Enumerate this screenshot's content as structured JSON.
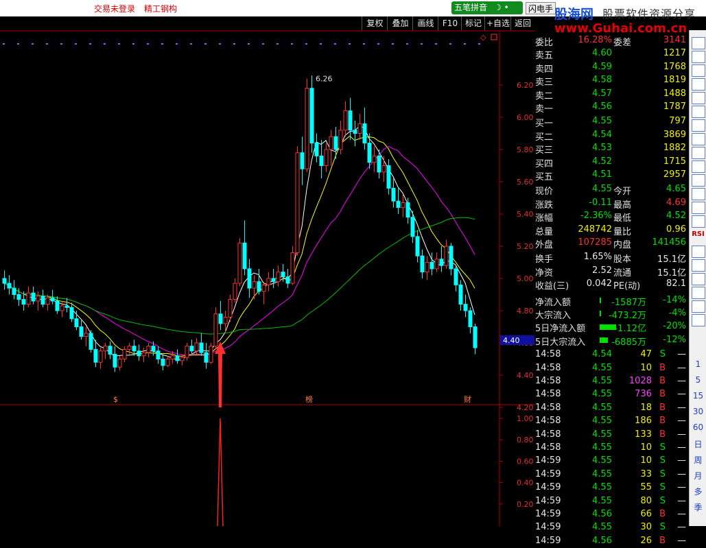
{
  "topbar": {
    "login_status": "交易未登录",
    "stock_name": "精工钢构",
    "ime": "五笔拼音",
    "flash": "闪电手"
  },
  "watermark": {
    "cn": "股海网",
    "tagline": "股票软件资源分享",
    "url": "www.Guhai.com.cn"
  },
  "toolbar": [
    "复权",
    "叠加",
    "画线",
    "F10",
    "标记",
    "+自选",
    "返回"
  ],
  "chart_data": [
    {
      "type": "candlestick",
      "y_ticks": [
        "6.20",
        "6.00",
        "5.80",
        "5.60",
        "5.40",
        "5.20",
        "5.00",
        "4.80",
        "4.60",
        "4.40",
        "4.20"
      ],
      "ylim": [
        4.12,
        6.32
      ],
      "high_label": "6.26",
      "cursor_price": "4.40",
      "series_colors": {
        "up": "#ff3232",
        "down": "#00ffff",
        "ma5": "#ffffff",
        "ma10": "#ffff00",
        "ma20": "#ff00ff",
        "ma60": "#00c000"
      },
      "ohlc": [
        [
          5.0,
          5.05,
          4.93,
          4.97
        ],
        [
          4.97,
          5.02,
          4.9,
          4.94
        ],
        [
          4.94,
          4.99,
          4.87,
          4.9
        ],
        [
          4.9,
          4.94,
          4.83,
          4.87
        ],
        [
          4.87,
          4.92,
          4.8,
          4.84
        ],
        [
          4.84,
          4.95,
          4.82,
          4.91
        ],
        [
          4.91,
          4.95,
          4.84,
          4.86
        ],
        [
          4.86,
          4.92,
          4.8,
          4.89
        ],
        [
          4.89,
          4.93,
          4.82,
          4.84
        ],
        [
          4.84,
          4.9,
          4.8,
          4.88
        ],
        [
          4.88,
          4.93,
          4.84,
          4.86
        ],
        [
          4.86,
          4.89,
          4.78,
          4.8
        ],
        [
          4.8,
          4.86,
          4.76,
          4.83
        ],
        [
          4.83,
          4.88,
          4.79,
          4.82
        ],
        [
          4.82,
          4.85,
          4.73,
          4.75
        ],
        [
          4.75,
          4.8,
          4.68,
          4.7
        ],
        [
          4.7,
          4.74,
          4.62,
          4.64
        ],
        [
          4.64,
          4.7,
          4.58,
          4.66
        ],
        [
          4.66,
          4.68,
          4.54,
          4.56
        ],
        [
          4.56,
          4.62,
          4.45,
          4.48
        ],
        [
          4.48,
          4.57,
          4.44,
          4.55
        ],
        [
          4.55,
          4.6,
          4.5,
          4.58
        ],
        [
          4.58,
          4.61,
          4.5,
          4.53
        ],
        [
          4.53,
          4.58,
          4.42,
          4.45
        ],
        [
          4.45,
          4.52,
          4.43,
          4.5
        ],
        [
          4.5,
          4.58,
          4.48,
          4.56
        ],
        [
          4.56,
          4.6,
          4.53,
          4.58
        ],
        [
          4.58,
          4.62,
          4.52,
          4.55
        ],
        [
          4.55,
          4.59,
          4.49,
          4.52
        ],
        [
          4.52,
          4.57,
          4.48,
          4.54
        ],
        [
          4.54,
          4.6,
          4.51,
          4.58
        ],
        [
          4.58,
          4.61,
          4.52,
          4.55
        ],
        [
          4.55,
          4.58,
          4.47,
          4.5
        ],
        [
          4.5,
          4.53,
          4.43,
          4.46
        ],
        [
          4.46,
          4.52,
          4.45,
          4.5
        ],
        [
          4.5,
          4.55,
          4.47,
          4.52
        ],
        [
          4.52,
          4.56,
          4.47,
          4.49
        ],
        [
          4.49,
          4.53,
          4.46,
          4.51
        ],
        [
          4.51,
          4.6,
          4.49,
          4.58
        ],
        [
          4.58,
          4.62,
          4.53,
          4.55
        ],
        [
          4.55,
          4.63,
          4.52,
          4.6
        ],
        [
          4.6,
          4.66,
          4.52,
          4.54
        ],
        [
          4.54,
          4.6,
          4.44,
          4.48
        ],
        [
          4.48,
          4.6,
          4.47,
          4.58
        ],
        [
          4.58,
          4.82,
          4.56,
          4.78
        ],
        [
          4.78,
          4.86,
          4.68,
          4.72
        ],
        [
          4.72,
          4.8,
          4.66,
          4.76
        ],
        [
          4.76,
          4.9,
          4.73,
          4.87
        ],
        [
          4.87,
          5.0,
          4.85,
          4.97
        ],
        [
          4.97,
          5.25,
          4.95,
          5.22
        ],
        [
          5.22,
          5.36,
          5.02,
          5.06
        ],
        [
          5.06,
          5.12,
          4.88,
          4.94
        ],
        [
          4.94,
          5.02,
          4.87,
          4.98
        ],
        [
          4.98,
          5.06,
          4.9,
          4.92
        ],
        [
          4.92,
          4.98,
          4.84,
          4.96
        ],
        [
          4.96,
          5.04,
          4.92,
          5.0
        ],
        [
          5.0,
          5.06,
          4.94,
          4.98
        ],
        [
          4.98,
          5.08,
          4.95,
          5.04
        ],
        [
          5.04,
          5.09,
          4.98,
          5.01
        ],
        [
          5.01,
          5.06,
          4.94,
          4.97
        ],
        [
          4.97,
          5.2,
          4.96,
          5.16
        ],
        [
          5.16,
          5.82,
          5.14,
          5.78
        ],
        [
          5.78,
          5.88,
          5.58,
          5.68
        ],
        [
          5.68,
          6.24,
          5.66,
          6.18
        ],
        [
          6.18,
          6.26,
          5.78,
          5.84
        ],
        [
          5.84,
          5.9,
          5.72,
          5.76
        ],
        [
          5.76,
          5.86,
          5.62,
          5.7
        ],
        [
          5.7,
          5.84,
          5.66,
          5.8
        ],
        [
          5.8,
          5.92,
          5.7,
          5.88
        ],
        [
          5.88,
          5.94,
          5.74,
          5.8
        ],
        [
          5.8,
          5.98,
          5.77,
          5.92
        ],
        [
          5.92,
          6.1,
          5.88,
          6.04
        ],
        [
          6.04,
          6.12,
          5.86,
          5.92
        ],
        [
          5.92,
          5.98,
          5.82,
          5.9
        ],
        [
          5.9,
          6.02,
          5.86,
          5.96
        ],
        [
          5.96,
          6.06,
          5.8,
          5.84
        ],
        [
          5.84,
          5.9,
          5.68,
          5.72
        ],
        [
          5.72,
          5.82,
          5.66,
          5.76
        ],
        [
          5.76,
          5.8,
          5.62,
          5.66
        ],
        [
          5.66,
          5.76,
          5.6,
          5.7
        ],
        [
          5.7,
          5.74,
          5.52,
          5.56
        ],
        [
          5.56,
          5.62,
          5.44,
          5.48
        ],
        [
          5.48,
          5.56,
          5.4,
          5.44
        ],
        [
          5.44,
          5.52,
          5.38,
          5.47
        ],
        [
          5.47,
          5.5,
          5.34,
          5.38
        ],
        [
          5.38,
          5.42,
          5.22,
          5.26
        ],
        [
          5.26,
          5.3,
          5.1,
          5.14
        ],
        [
          5.14,
          5.18,
          5.0,
          5.04
        ],
        [
          5.04,
          5.14,
          4.99,
          5.1
        ],
        [
          5.1,
          5.16,
          5.02,
          5.06
        ],
        [
          5.06,
          5.16,
          5.04,
          5.12
        ],
        [
          5.12,
          5.2,
          5.04,
          5.08
        ],
        [
          5.08,
          5.24,
          5.06,
          5.2
        ],
        [
          5.2,
          5.22,
          5.02,
          5.06
        ],
        [
          5.06,
          5.08,
          4.92,
          4.96
        ],
        [
          4.96,
          4.99,
          4.8,
          4.84
        ],
        [
          4.84,
          4.9,
          4.76,
          4.8
        ],
        [
          4.8,
          4.82,
          4.66,
          4.7
        ],
        [
          4.7,
          4.72,
          4.53,
          4.57
        ]
      ]
    },
    {
      "type": "signal",
      "y_ticks": [
        "1.00",
        "0.80",
        "0.60",
        "0.40",
        "0.20"
      ],
      "ylim": [
        0,
        1.1
      ],
      "signal_index": 45,
      "signal_value": 1.0
    }
  ],
  "event_markers": [
    {
      "label": "$",
      "index": 23
    },
    {
      "label": "榜",
      "index": 63
    },
    {
      "label": "财",
      "index": 96
    }
  ],
  "quote": {
    "webi_label": "委比",
    "webi": "16.28%",
    "wecha_label": "委差",
    "wecha": "3141",
    "asks": [
      {
        "label": "卖五",
        "price": "4.60",
        "vol": "1217"
      },
      {
        "label": "卖四",
        "price": "4.59",
        "vol": "1768"
      },
      {
        "label": "卖三",
        "price": "4.58",
        "vol": "1819"
      },
      {
        "label": "卖二",
        "price": "4.57",
        "vol": "1488"
      },
      {
        "label": "卖一",
        "price": "4.56",
        "vol": "1787"
      }
    ],
    "bids": [
      {
        "label": "买一",
        "price": "4.55",
        "vol": "797"
      },
      {
        "label": "买二",
        "price": "4.54",
        "vol": "3869"
      },
      {
        "label": "买三",
        "price": "4.53",
        "vol": "1882"
      },
      {
        "label": "买四",
        "price": "4.52",
        "vol": "1715"
      },
      {
        "label": "买五",
        "price": "4.51",
        "vol": "2957"
      }
    ],
    "stats": [
      {
        "l1": "现价",
        "v1": "4.55",
        "c1": "g",
        "l2": "今开",
        "v2": "4.65",
        "c2": "g"
      },
      {
        "l1": "涨跌",
        "v1": "-0.11",
        "c1": "g",
        "l2": "最高",
        "v2": "4.69",
        "c2": "r"
      },
      {
        "l1": "涨幅",
        "v1": "-2.36%",
        "c1": "g",
        "l2": "最低",
        "v2": "4.52",
        "c2": "g"
      },
      {
        "l1": "总量",
        "v1": "248742",
        "c1": "y",
        "l2": "量比",
        "v2": "0.96",
        "c2": "y"
      },
      {
        "l1": "外盘",
        "v1": "107285",
        "c1": "r",
        "l2": "内盘",
        "v2": "141456",
        "c2": "g"
      }
    ],
    "stats2": [
      {
        "l1": "换手",
        "v1": "1.65%",
        "l2": "股本",
        "v2": "15.1亿"
      },
      {
        "l1": "净资",
        "v1": "2.52",
        "l2": "流通",
        "v2": "15.1亿"
      },
      {
        "l1": "收益(三)",
        "v1": "0.042",
        "l2": "PE(动)",
        "v2": "82.1"
      }
    ],
    "flows": [
      {
        "label": "净流入额",
        "v1": "-1587万",
        "v2": "-14%"
      },
      {
        "label": "大宗流入",
        "v1": "-473.2万",
        "v2": "-4%"
      },
      {
        "label": "5日净流入额",
        "v1": "-1.12亿",
        "v2": "-20%"
      },
      {
        "label": "5日大宗流入",
        "v1": "-6885万",
        "v2": "-12%"
      }
    ],
    "ticks": [
      {
        "t": "14:58",
        "p": "4.54",
        "v": "47",
        "s": "S"
      },
      {
        "t": "14:58",
        "p": "4.55",
        "v": "10",
        "s": "B"
      },
      {
        "t": "14:58",
        "p": "4.55",
        "v": "1028",
        "s": "B"
      },
      {
        "t": "14:58",
        "p": "4.55",
        "v": "736",
        "s": "B"
      },
      {
        "t": "14:58",
        "p": "4.55",
        "v": "18",
        "s": "B"
      },
      {
        "t": "14:58",
        "p": "4.55",
        "v": "186",
        "s": "B"
      },
      {
        "t": "14:58",
        "p": "4.55",
        "v": "133",
        "s": "B"
      },
      {
        "t": "14:58",
        "p": "4.55",
        "v": "10",
        "s": "S"
      },
      {
        "t": "14:59",
        "p": "4.55",
        "v": "10",
        "s": "S"
      },
      {
        "t": "14:59",
        "p": "4.55",
        "v": "33",
        "s": "S"
      },
      {
        "t": "14:59",
        "p": "4.55",
        "v": "55",
        "s": "S"
      },
      {
        "t": "14:59",
        "p": "4.55",
        "v": "80",
        "s": "S"
      },
      {
        "t": "14:59",
        "p": "4.56",
        "v": "66",
        "s": "B"
      },
      {
        "t": "14:59",
        "p": "4.55",
        "v": "30",
        "s": "S"
      },
      {
        "t": "14:59",
        "p": "4.56",
        "v": "26",
        "s": "B"
      }
    ],
    "tick_dash": "—"
  },
  "side": {
    "buttons": [
      "1",
      "5",
      "15",
      "30",
      "60",
      "日",
      "周",
      "月",
      "多",
      "季"
    ],
    "rsi": "RSI",
    "f10": "F10"
  }
}
